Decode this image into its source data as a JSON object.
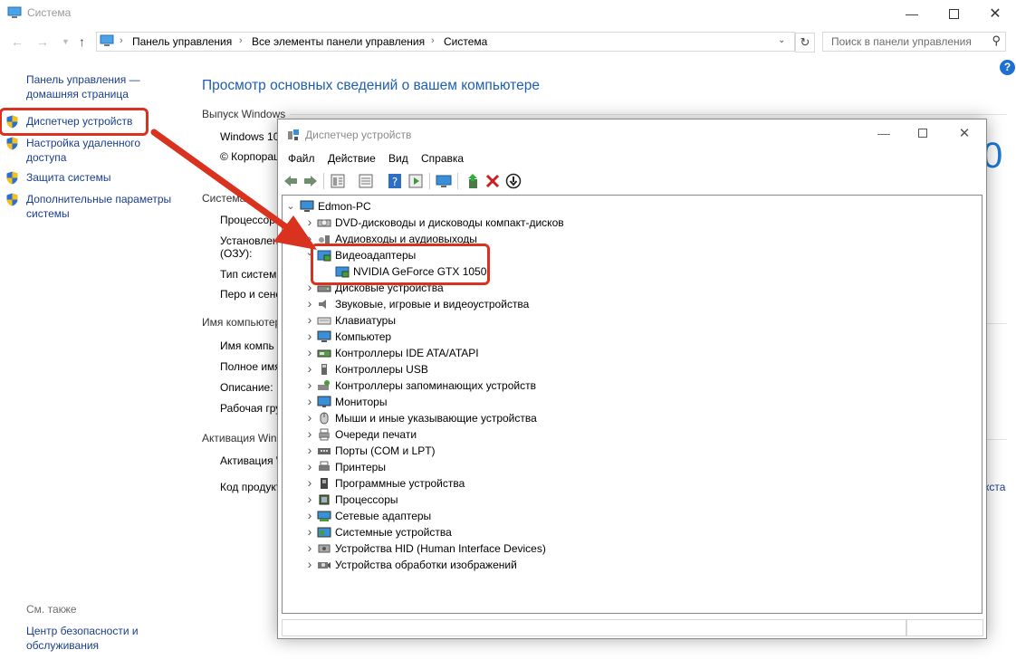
{
  "window": {
    "title": "Система"
  },
  "address": {
    "crumbs": [
      "Панель управления",
      "Все элементы панели управления",
      "Система"
    ]
  },
  "search": {
    "placeholder": "Поиск в панели управления"
  },
  "sidebar": {
    "home": "Панель управления — домашняя страница",
    "items": [
      {
        "label": "Диспетчер устройств"
      },
      {
        "label": "Настройка удаленного доступа"
      },
      {
        "label": "Защита системы"
      },
      {
        "label": "Дополнительные параметры системы"
      }
    ],
    "see_also": "См. также",
    "security_center": "Центр безопасности и обслуживания"
  },
  "main": {
    "heading": "Просмотр основных сведений о вашем компьютере",
    "sections": [
      {
        "title": "Выпуск Windows",
        "rows": [
          "Windows 10",
          "© Корпорация"
        ]
      },
      {
        "title": "Система",
        "rows": [
          "Процессор",
          "Установлен",
          "(ОЗУ):",
          "Тип систем",
          "Перо и сенс"
        ]
      },
      {
        "title": "Имя компьютера",
        "rows": [
          "Имя компь",
          "Полное имя",
          "Описание:",
          "Рабочая гру"
        ]
      },
      {
        "title": "Активация Windo",
        "rows": [
          "Активация W",
          "Код продукта"
        ]
      }
    ],
    "partial_link": "кста"
  },
  "devmgr": {
    "title": "Диспетчер устройств",
    "menu": [
      "Файл",
      "Действие",
      "Вид",
      "Справка"
    ],
    "root": "Edmon-PC",
    "categories": [
      {
        "label": "DVD-дисководы и дисководы компакт-дисков",
        "icon": "dvd-icon",
        "expanded": false
      },
      {
        "label": "Аудиовходы и аудиовыходы",
        "icon": "audio-icon",
        "expanded": false
      },
      {
        "label": "Видеоадаптеры",
        "icon": "display-adapter-icon",
        "expanded": true
      },
      {
        "label": "NVIDIA GeForce GTX 1050",
        "icon": "display-adapter-icon",
        "child": true
      },
      {
        "label": "Дисковые устройства",
        "icon": "disk-icon",
        "expanded": false
      },
      {
        "label": "Звуковые, игровые и видеоустройства",
        "icon": "speaker-icon",
        "expanded": false
      },
      {
        "label": "Клавиатуры",
        "icon": "keyboard-icon",
        "expanded": false
      },
      {
        "label": "Компьютер",
        "icon": "computer-icon",
        "expanded": false
      },
      {
        "label": "Контроллеры IDE ATA/ATAPI",
        "icon": "ide-icon",
        "expanded": false
      },
      {
        "label": "Контроллеры USB",
        "icon": "usb-icon",
        "expanded": false
      },
      {
        "label": "Контроллеры запоминающих устройств",
        "icon": "storage-icon",
        "expanded": false
      },
      {
        "label": "Мониторы",
        "icon": "monitor-icon",
        "expanded": false
      },
      {
        "label": "Мыши и иные указывающие устройства",
        "icon": "mouse-icon",
        "expanded": false
      },
      {
        "label": "Очереди печати",
        "icon": "print-queue-icon",
        "expanded": false
      },
      {
        "label": "Порты (COM и LPT)",
        "icon": "port-icon",
        "expanded": false
      },
      {
        "label": "Принтеры",
        "icon": "printer-icon",
        "expanded": false
      },
      {
        "label": "Программные устройства",
        "icon": "software-device-icon",
        "expanded": false
      },
      {
        "label": "Процессоры",
        "icon": "cpu-icon",
        "expanded": false
      },
      {
        "label": "Сетевые адаптеры",
        "icon": "network-icon",
        "expanded": false
      },
      {
        "label": "Системные устройства",
        "icon": "system-icon",
        "expanded": false
      },
      {
        "label": "Устройства HID (Human Interface Devices)",
        "icon": "hid-icon",
        "expanded": false
      },
      {
        "label": "Устройства обработки изображений",
        "icon": "camera-icon",
        "expanded": false
      }
    ]
  },
  "colors": {
    "accent": "#1e5fb4",
    "link": "#1a3e8c",
    "highlight": "#d9321f"
  }
}
